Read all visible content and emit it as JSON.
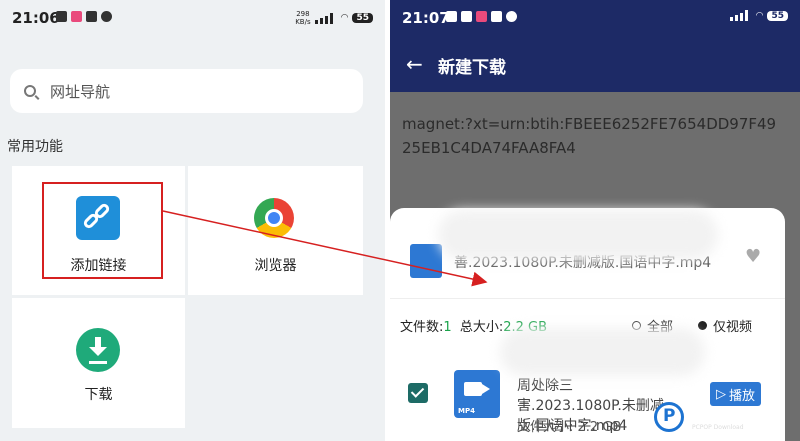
{
  "left": {
    "status": {
      "time": "21:06",
      "speed_top": "298",
      "speed_unit": "KB/s",
      "battery": "55"
    },
    "search": {
      "placeholder": "网址导航"
    },
    "section_title": "常用功能",
    "tiles": [
      {
        "label": "添加链接",
        "icon": "link-icon"
      },
      {
        "label": "浏览器",
        "icon": "chrome-icon"
      },
      {
        "label": "下载",
        "icon": "download-icon"
      }
    ]
  },
  "right": {
    "status": {
      "time": "21:07",
      "battery": "55"
    },
    "appbar": {
      "title": "新建下载"
    },
    "magnet_text": "magnet:?xt=urn:btih:FBEEE6252FE7654DD97F4925EB1C4DA74FAA8FA4",
    "sheet": {
      "file_name_line2": "善.2023.1080P.未删减版.国语中字.mp4",
      "file_count_label": "文件数:",
      "file_count": "1",
      "total_size_label": "总大小:",
      "total_size": "2.2 GB",
      "filter_all": "全部",
      "filter_video": "仅视频",
      "item": {
        "name": "周处除三害.2023.1080P.未删减版.国语中字.mp4",
        "size": "文件大小: 2.2 GB",
        "play_label": "播放",
        "icon_tag": "MP4"
      }
    }
  },
  "watermark": {
    "brand": "PCPOP下载",
    "sub": "PCPOP Download"
  },
  "colors": {
    "highlight": "#d62020",
    "appbar": "#1d2a66",
    "accent": "#2d78d3",
    "green": "#1aa34a"
  }
}
